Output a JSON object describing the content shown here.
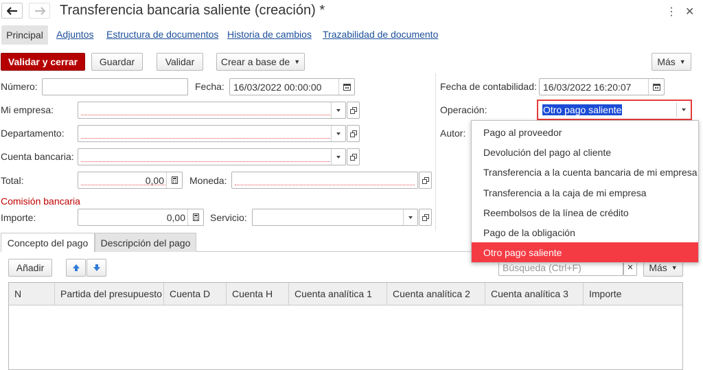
{
  "window": {
    "title": "Transferencia bancaria saliente (creación) *",
    "more_icon": "⋮",
    "close_icon": "✕"
  },
  "nav_links": {
    "principal": "Principal",
    "adjuntos": "Adjuntos",
    "estructura": "Estructura de documentos",
    "historia": "Historia de cambios",
    "trazabilidad": "Trazabilidad de documento"
  },
  "toolbar": {
    "validar_cerrar": "Validar y cerrar",
    "guardar": "Guardar",
    "validar": "Validar",
    "crear_base": "Crear a base de",
    "mas": "Más"
  },
  "form": {
    "numero_label": "Número:",
    "numero_value": "",
    "fecha_label": "Fecha:",
    "fecha_value": "16/03/2022 00:00:00",
    "fecha_contabilidad_label": "Fecha de contabilidad:",
    "fecha_contabilidad_value": "16/03/2022 16:20:07",
    "empresa_label": "Mi empresa:",
    "operacion_label": "Operación:",
    "operacion_value": "Otro pago saliente",
    "departamento_label": "Departamento:",
    "autor_label": "Autor:",
    "cuenta_label": "Cuenta bancaria:",
    "total_label": "Total:",
    "total_value": "0,00",
    "moneda_label": "Moneda:",
    "comision_label": "Comisión bancaria",
    "importe_label": "Importe:",
    "importe_value": "0,00",
    "servicio_label": "Servicio:"
  },
  "operation_options": [
    "Pago al proveedor",
    "Devolución del pago al cliente",
    "Transferencia a la cuenta bancaria de mi empresa",
    "Transferencia a la caja de mi empresa",
    "Reembolsos de la línea de crédito",
    "Pago de la obligación",
    "Otro pago saliente"
  ],
  "tabs": {
    "concepto": "Concepto del pago",
    "descripcion": "Descripción del pago"
  },
  "table_toolbar": {
    "anadir": "Añadir",
    "search_placeholder": "Búsqueda (Ctrl+F)",
    "mas": "Más"
  },
  "table": {
    "columns": [
      "N",
      "Partida del presupuesto",
      "Cuenta D",
      "Cuenta H",
      "Cuenta analítica 1",
      "Cuenta analítica 2",
      "Cuenta analítica 3",
      "Importe"
    ]
  },
  "colors": {
    "primary": "#b60000",
    "link": "#1c4f9a",
    "selection": "#1c4cd6",
    "menu_active": "#f43b44"
  }
}
